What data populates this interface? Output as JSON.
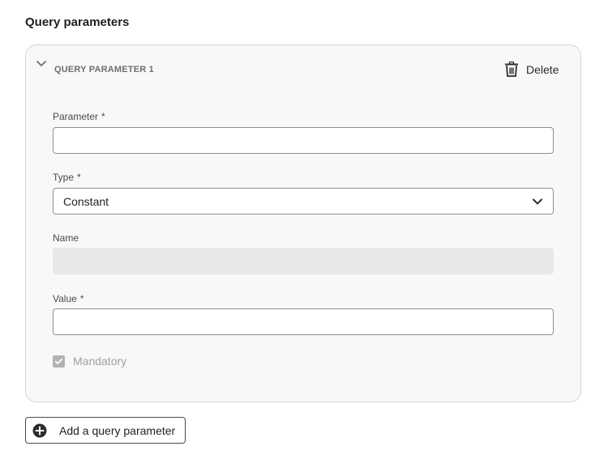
{
  "section": {
    "title": "Query parameters"
  },
  "card": {
    "title": "QUERY PARAMETER 1",
    "delete_label": "Delete",
    "fields": {
      "parameter": {
        "label": "Parameter",
        "required_mark": "*",
        "value": ""
      },
      "type": {
        "label": "Type",
        "required_mark": "*",
        "selected": "Constant"
      },
      "name": {
        "label": "Name",
        "value": ""
      },
      "value": {
        "label": "Value",
        "required_mark": "*",
        "value": ""
      }
    },
    "mandatory": {
      "label": "Mandatory",
      "checked": true,
      "disabled": true
    }
  },
  "add_button": {
    "label": "Add a query parameter"
  },
  "icons": {
    "collapse": "chevron-down-icon",
    "delete": "trash-icon",
    "dropdown": "chevron-down-icon",
    "checkbox": "checkmark-icon",
    "add": "add-circle-icon"
  }
}
